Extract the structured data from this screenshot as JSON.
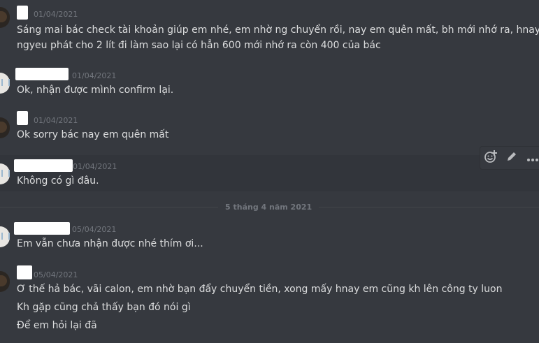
{
  "messages": [
    {
      "timestamp": "01/04/2021",
      "lines": [
        "Sáng mai bác check tài khoản giúp em nhé, em nhờ ng chuyển rồi, nay em quên mất, bh mới nhớ ra, hnay",
        "ngyeu phát cho 2 lít đi làm sao lại có hẳn 600 mới nhớ ra còn 400 của bác"
      ]
    },
    {
      "timestamp": "01/04/2021",
      "lines": [
        "Ok, nhận được mình confirm lại."
      ]
    },
    {
      "timestamp": "01/04/2021",
      "lines": [
        "Ok sorry bác nay em quên mất"
      ]
    },
    {
      "timestamp": "01/04/2021",
      "lines": [
        "Không có gì đâu."
      ]
    },
    {
      "timestamp": "05/04/2021",
      "lines": [
        "Em vẫn chưa nhận được nhé thím ơi..."
      ]
    },
    {
      "timestamp": "05/04/2021",
      "lines": [
        "Ơ thế hả bác, vãi calon, em nhờ bạn đẩy chuyển tiền, xong mấy hnay em cũng kh lên công ty luon",
        "Kh gặp cũng chả thấy bạn đó nói gì",
        "Để em hỏi lại đã"
      ]
    }
  ],
  "date_divider": "5 tháng 4 năm 2021",
  "toolbar": {
    "icons": [
      "add-reaction-icon",
      "edit-icon",
      "more-icon"
    ]
  },
  "colors": {
    "background": "#36393f",
    "text": "#dcddde",
    "muted": "#72767d"
  }
}
